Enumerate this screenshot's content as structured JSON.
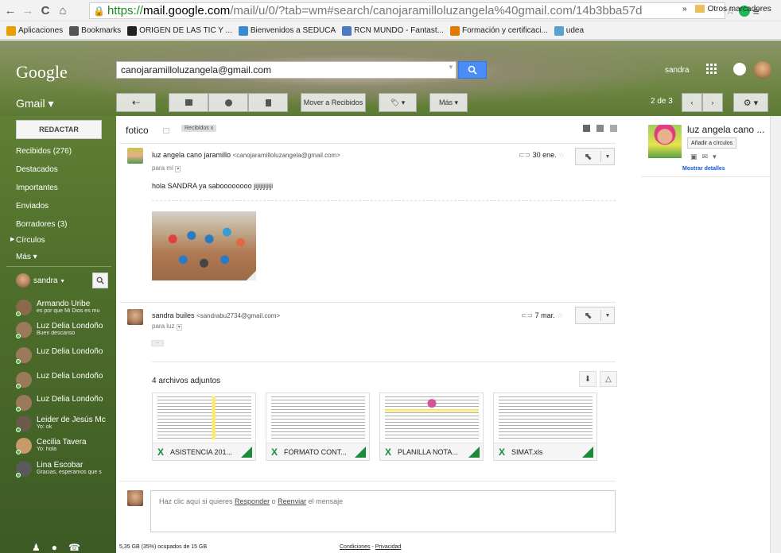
{
  "browser": {
    "url_https": "https://",
    "url_host": "mail.google.com",
    "url_path": "/mail/u/0/?tab=wm#search/canojaramilloluzangela%40gmail.com/14b3bba57d",
    "bookmarks": [
      {
        "label": "Aplicaciones",
        "color": "#e8a000"
      },
      {
        "label": "Bookmarks",
        "color": "#555555"
      },
      {
        "label": "ORIGEN DE LAS TIC Y ...",
        "color": "#222222"
      },
      {
        "label": "Bienvenidos a SEDUCA",
        "color": "#3a8ad0"
      },
      {
        "label": "RCN MUNDO - Fantast...",
        "color": "#4a7ac0"
      },
      {
        "label": "Formación y certificaci...",
        "color": "#e07a00"
      },
      {
        "label": "udea",
        "color": "#5aa0d0"
      }
    ],
    "bookmarks_more": "»",
    "other_bookmarks": "Otros marcadores"
  },
  "header": {
    "logo": "Google",
    "search_value": "canojaramilloluzangela@gmail.com",
    "user": "sandra",
    "gmail_label": "Gmail ▾"
  },
  "toolbar": {
    "move_to": "Mover a Recibidos",
    "more": "Más ▾",
    "pager": "2 de 3"
  },
  "sidebar": {
    "compose": "REDACTAR",
    "items": [
      "Recibidos (276)",
      "Destacados",
      "Importantes",
      "Enviados",
      "Borradores (3)",
      "Círculos",
      "Más ▾"
    ],
    "me": "sandra",
    "contacts": [
      {
        "name": "Armando Uribe",
        "status": "es por que Mi Dios es mu",
        "color": "#8a6a4a"
      },
      {
        "name": "Luz Delia Londoño",
        "status": "Buen descanso",
        "color": "#9a7a5a"
      },
      {
        "name": "Luz Delia Londoño",
        "status": "",
        "color": "#9a7a5a"
      },
      {
        "name": "Luz Delia Londoño",
        "status": "",
        "color": "#9a7a5a"
      },
      {
        "name": "Luz Delia Londoño",
        "status": "",
        "color": "#9a7a5a"
      },
      {
        "name": "Leider de Jesús Mc",
        "status": "Yo: ok",
        "color": "#6a5a4a"
      },
      {
        "name": "Cecilia Tavera",
        "status": "Yo: hola",
        "color": "#c89a6a"
      },
      {
        "name": "Lina Escobar",
        "status": "Gracias, esperamos que s",
        "color": "#5a5a5a"
      }
    ]
  },
  "thread": {
    "subject": "fotico",
    "label": "Recibidos",
    "label_close": "x",
    "msg1": {
      "sender": "luz angela cano jaramillo",
      "email": "<canojaramilloluzangela@gmail.com>",
      "to": "para mí",
      "date": "30 ene.",
      "body": "hola SANDRA  ya saboooooooo jijijijijiji"
    },
    "msg2": {
      "sender": "sandra builes",
      "email": "<sandrabu2734@gmail.com>",
      "to": "para luz",
      "date": "7 mar.",
      "ellipsis": "...",
      "attachments_title": "4 archivos adjuntos",
      "attachments": [
        "ASISTENCIA 201...",
        "FORMATO CONT...",
        "PLANILLA NOTA...",
        "SIMAT.xls"
      ]
    },
    "reply_prefix": "Haz clic aquí si quieres ",
    "reply_link": "Responder",
    "reply_mid": " o ",
    "forward_link": "Reenviar",
    "reply_suffix": " el mensaje"
  },
  "footer": {
    "storage": "5,35 GB (35%) ocupados de 15 GB",
    "conditions": "Condiciones",
    "sep": " - ",
    "privacy": "Privacidad"
  },
  "contact_panel": {
    "name": "luz angela cano ...",
    "add_circles": "Añadir a círculos",
    "details": "Mostrar detalles"
  }
}
